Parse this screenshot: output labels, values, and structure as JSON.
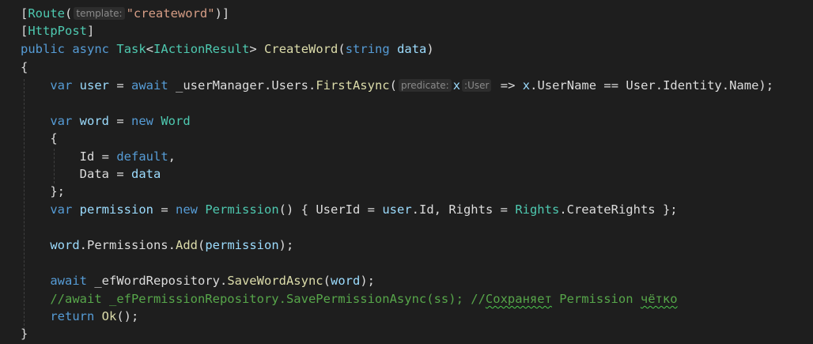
{
  "code": {
    "l1": {
      "open": "[",
      "attr": "Route",
      "paren": "(",
      "hint": "template:",
      "str": "\"createword\"",
      "close": ")]"
    },
    "l2": {
      "open": "[",
      "attr": "HttpPost",
      "close": "]"
    },
    "l3": {
      "kw1": "public",
      "kw2": "async",
      "ty1": "Task",
      "lt": "<",
      "ty2": "IActionResult",
      "gt": ">",
      "name": "CreateWord",
      "p1": "(",
      "kw3": "string",
      "param": "data",
      "p2": ")"
    },
    "l4": {
      "brace": "{"
    },
    "l5": {
      "kw1": "var",
      "v1": "user",
      "eq": " = ",
      "kw2": "await",
      "mid": " _userManager.Users.",
      "m": "FirstAsync",
      "p": "(",
      "hint1": "predicate:",
      "x": "x",
      "hint2": ":User",
      "arrow": " => ",
      "x2": "x",
      "rest": ".UserName == User.Identity.Name);"
    },
    "l7": {
      "kw1": "var",
      "v1": "word",
      "eq": " = ",
      "kw2": "new",
      "ty": "Word"
    },
    "l8": {
      "brace": "{"
    },
    "l9": {
      "prop": "Id",
      "eq": " = ",
      "kw": "default",
      "comma": ","
    },
    "l10": {
      "prop": "Data",
      "eq": " = ",
      "v": "data"
    },
    "l11": {
      "brace": "};"
    },
    "l12": {
      "kw1": "var",
      "v1": "permission",
      "eq": " = ",
      "kw2": "new",
      "ty": "Permission",
      "r1": "() { UserId = ",
      "v2": "user",
      "r2": ".Id, Rights = ",
      "ty2": "Rights",
      "r3": ".CreateRights };"
    },
    "l14": {
      "v": "word",
      "mid": ".Permissions.",
      "m": "Add",
      "p": "(",
      "v2": "permission",
      "end": ");"
    },
    "l16": {
      "kw": "await",
      "mid": " _efWordRepository.",
      "m": "SaveWordAsync",
      "p": "(",
      "v": "word",
      "end": ");"
    },
    "l17": {
      "c1": "//await _efPermissionRepository.SavePermissionAsync(ss); //",
      "c2": "Сохраняет",
      "c3": " Permission ",
      "c4": "чётко"
    },
    "l18": {
      "kw": "return",
      "sp": " ",
      "m": "Ok",
      "end": "();"
    },
    "l19": {
      "brace": "}"
    }
  }
}
